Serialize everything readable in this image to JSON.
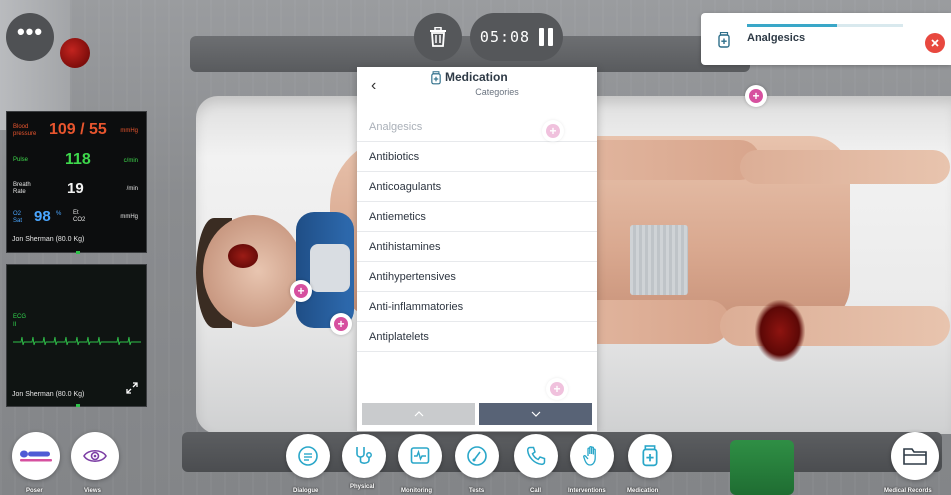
{
  "top": {
    "menu_glyph": "•••",
    "timer": "05:08"
  },
  "notification": {
    "title": "Analgesics",
    "progress": 0.58,
    "icon": "medication-icon",
    "close_icon": "close-icon"
  },
  "vitals": {
    "bp_label": "Blood pressure",
    "bp_value": "109 / 55",
    "bp_unit": "mmHg",
    "pulse_label": "Pulse",
    "pulse_value": "118",
    "pulse_unit": "c/min",
    "breath_label": "Breath Rate",
    "breath_value": "19",
    "breath_unit": "/min",
    "o2_label": "O2 Sat",
    "o2_value": "98",
    "o2_unit": "%",
    "co2_label": "Et CO2",
    "co2_unit": "mmHg",
    "patient": "Jon Sherman (80.0 Kg)"
  },
  "ecg": {
    "label": "ECG",
    "lead": "II",
    "patient": "Jon Sherman (80.0 Kg)"
  },
  "medication": {
    "title": "Medication",
    "subtitle": "Categories",
    "items": [
      {
        "label": "Analgesics",
        "disabled": true
      },
      {
        "label": "Antibiotics",
        "disabled": false
      },
      {
        "label": "Anticoagulants",
        "disabled": false
      },
      {
        "label": "Antiemetics",
        "disabled": false
      },
      {
        "label": "Antihistamines",
        "disabled": false
      },
      {
        "label": "Antihypertensives",
        "disabled": false
      },
      {
        "label": "Anti-inflammatories",
        "disabled": false
      },
      {
        "label": "Antiplatelets",
        "disabled": false
      }
    ]
  },
  "bottom": {
    "left_labels": [
      "Poser",
      "Views"
    ],
    "tabs": [
      "Dialogue",
      "Physical",
      "Monitoring",
      "Tests",
      "Call",
      "Interventions",
      "Medication"
    ],
    "right_label": "Medical Records"
  },
  "colors": {
    "bp": "#e8552e",
    "pulse": "#3ed84c",
    "o2": "#4aa6ff",
    "accent": "#3aa7c8",
    "close": "#e8483f",
    "marker": "#d6509f"
  }
}
